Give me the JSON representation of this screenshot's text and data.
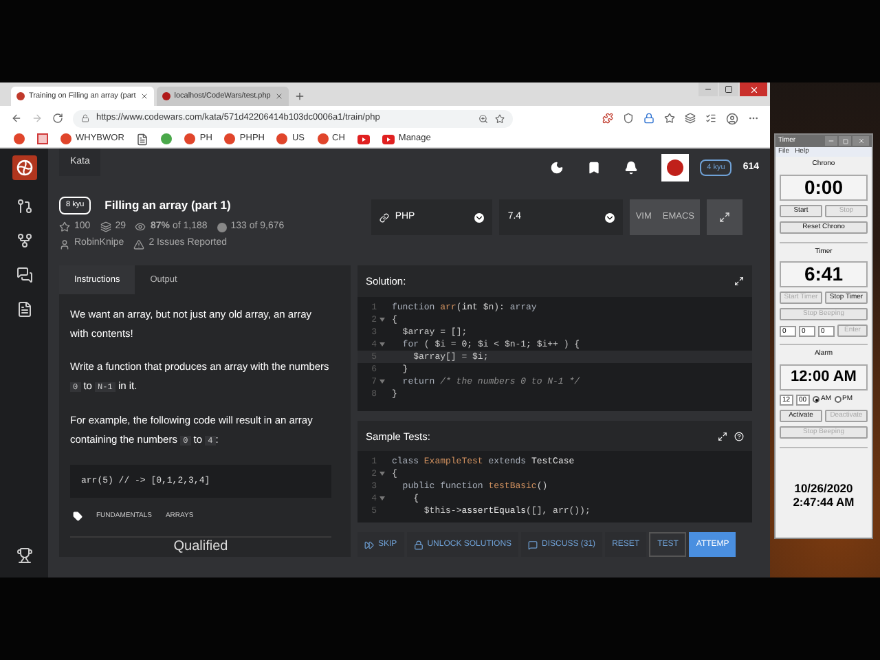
{
  "browser": {
    "tabs": [
      {
        "title": "Training on Filling an array (part",
        "selected": true
      },
      {
        "title": "localhost/CodeWars/test.php",
        "selected": false
      }
    ],
    "url": "https://www.codewars.com/kata/571d42206414b103dc0006a1/train/php",
    "bookmarks": [
      {
        "kind": "round"
      },
      {
        "kind": "square"
      },
      {
        "kind": "round",
        "label": "WHYBWOR"
      },
      {
        "kind": "page"
      },
      {
        "kind": "leaf"
      },
      {
        "kind": "round",
        "label": "PH"
      },
      {
        "kind": "round",
        "label": "PHPH"
      },
      {
        "kind": "round",
        "label": "US"
      },
      {
        "kind": "round",
        "label": "CH"
      },
      {
        "kind": "video"
      },
      {
        "kind": "video",
        "label": "Manage"
      }
    ]
  },
  "nav": {
    "section": "Kata"
  },
  "user": {
    "rank": "4 kyu",
    "honor": "614"
  },
  "kata": {
    "rank": "8 kyu",
    "title": "Filling an array (part 1)",
    "stats": [
      {
        "kind": "star",
        "text": "100"
      },
      {
        "kind": "stack",
        "text": "29"
      },
      {
        "kind": "eye",
        "text": "**87%** of 1,188"
      },
      {
        "kind": "count",
        "text": "133 of 9,676"
      },
      {
        "kind": "user",
        "text": "RobinKnipe"
      },
      {
        "kind": "warning",
        "text": "2 Issues Reported"
      }
    ]
  },
  "editor_bar": {
    "language": "PHP",
    "version": "7.4",
    "modes": [
      "VIM",
      "EMACS"
    ]
  },
  "instructions": {
    "tabs": [
      {
        "label": "Instructions",
        "selected": true
      },
      {
        "label": "Output",
        "selected": false
      }
    ],
    "paragraphs": [
      [
        {
          "kind": "text",
          "text": "We want an array, but not just any old array, an array with contents!"
        }
      ],
      [
        {
          "kind": "text",
          "text": "Write a function that produces an array with the numbers "
        },
        {
          "kind": "code",
          "text": "0"
        },
        {
          "kind": "text",
          "text": " to "
        },
        {
          "kind": "code",
          "text": "N-1"
        },
        {
          "kind": "text",
          "text": " in it."
        }
      ],
      [
        {
          "kind": "text",
          "text": "For example, the following code will result in an array containing the numbers "
        },
        {
          "kind": "code",
          "text": "0"
        },
        {
          "kind": "text",
          "text": " to "
        },
        {
          "kind": "code",
          "text": "4"
        },
        {
          "kind": "text",
          "text": ":"
        }
      ]
    ],
    "example": "arr(5) // -> [0,1,2,3,4]",
    "tags": [
      "FUNDAMENTALS",
      "ARRAYS"
    ],
    "footer": "Qualified"
  },
  "solution": {
    "title": "Solution:",
    "lines": [
      {
        "num": "1",
        "fold": false,
        "current": false,
        "tokens": [
          {
            "kind": "kw",
            "text": "function "
          },
          {
            "kind": "fn",
            "text": "arr"
          },
          {
            "kind": "plain",
            "text": "("
          },
          {
            "kind": "type",
            "text": "int"
          },
          {
            "kind": "var",
            "text": " $n"
          },
          {
            "kind": "plain",
            "text": "): "
          },
          {
            "kind": "kw",
            "text": "array"
          }
        ]
      },
      {
        "num": "2",
        "fold": true,
        "current": false,
        "tokens": [
          {
            "kind": "plain",
            "text": "{"
          }
        ]
      },
      {
        "num": "3",
        "fold": false,
        "current": false,
        "tokens": [
          {
            "kind": "var",
            "text": "  $array"
          },
          {
            "kind": "plain",
            "text": " = [];"
          }
        ]
      },
      {
        "num": "4",
        "fold": true,
        "current": false,
        "tokens": [
          {
            "kind": "kw",
            "text": "  for"
          },
          {
            "kind": "plain",
            "text": " ( $i = "
          },
          {
            "kind": "num",
            "text": "0"
          },
          {
            "kind": "plain",
            "text": "; $i < $n-1; $i++ ) {"
          }
        ]
      },
      {
        "num": "5",
        "fold": false,
        "current": true,
        "tokens": [
          {
            "kind": "var",
            "text": "    $array"
          },
          {
            "kind": "plain",
            "text": "[] = $i;"
          }
        ]
      },
      {
        "num": "6",
        "fold": false,
        "current": false,
        "tokens": [
          {
            "kind": "plain",
            "text": "  }"
          }
        ]
      },
      {
        "num": "7",
        "fold": true,
        "current": false,
        "tokens": [
          {
            "kind": "kw",
            "text": "  return "
          },
          {
            "kind": "comment",
            "text": "/* the numbers 0 to N-1 */"
          }
        ]
      },
      {
        "num": "8",
        "fold": false,
        "current": false,
        "tokens": [
          {
            "kind": "plain",
            "text": "}"
          }
        ]
      }
    ]
  },
  "tests": {
    "title": "Sample Tests:",
    "lines": [
      {
        "num": "1",
        "fold": false,
        "current": false,
        "tokens": [
          {
            "kind": "kw",
            "text": "class "
          },
          {
            "kind": "fn",
            "text": "ExampleTest"
          },
          {
            "kind": "kw",
            "text": " extends "
          },
          {
            "kind": "type",
            "text": "TestCase"
          }
        ]
      },
      {
        "num": "2",
        "fold": true,
        "current": false,
        "tokens": [
          {
            "kind": "plain",
            "text": "{"
          }
        ]
      },
      {
        "num": "3",
        "fold": false,
        "current": false,
        "tokens": [
          {
            "kind": "kw",
            "text": "  public function "
          },
          {
            "kind": "fn",
            "text": "testBasic"
          },
          {
            "kind": "plain",
            "text": "()"
          }
        ]
      },
      {
        "num": "4",
        "fold": true,
        "current": false,
        "tokens": [
          {
            "kind": "plain",
            "text": "    {"
          }
        ]
      },
      {
        "num": "5",
        "fold": false,
        "current": false,
        "tokens": [
          {
            "kind": "var",
            "text": "      $this"
          },
          {
            "kind": "plain",
            "text": "->"
          },
          {
            "kind": "type",
            "text": "assertEquals"
          },
          {
            "kind": "plain",
            "text": "([], arr());"
          }
        ]
      }
    ]
  },
  "actions": [
    {
      "kind": "skip",
      "label": "SKIP"
    },
    {
      "kind": "unlock",
      "label": "UNLOCK SOLUTIONS"
    },
    {
      "kind": "discuss",
      "label": "DISCUSS (31)"
    },
    {
      "kind": "plain",
      "label": "RESET"
    },
    {
      "kind": "outline",
      "label": "TEST"
    },
    {
      "kind": "primary",
      "label": "ATTEMP"
    }
  ],
  "timer_app": {
    "title": "Timer",
    "menu": [
      "File",
      "Help"
    ],
    "chrono": {
      "label": "Chrono",
      "display": "0:00",
      "buttons": [
        {
          "label": "Start",
          "disabled": false
        },
        {
          "label": "Stop",
          "disabled": true
        }
      ],
      "reset": {
        "label": "Reset Chrono",
        "disabled": false
      }
    },
    "timer": {
      "label": "Timer",
      "display": "6:41",
      "buttons": [
        {
          "label": "Start Timer",
          "disabled": true
        },
        {
          "label": "Stop Timer",
          "disabled": false
        }
      ],
      "beep": {
        "label": "Stop Beeping",
        "disabled": true
      },
      "fields": [
        "0",
        "0",
        "0"
      ],
      "enter": {
        "label": "Enter",
        "disabled": true
      }
    },
    "alarm": {
      "label": "Alarm",
      "display": "12:00 AM",
      "fields": [
        "12",
        "00"
      ],
      "periods": [
        {
          "label": "AM",
          "selected": true
        },
        {
          "label": "PM",
          "selected": false
        }
      ],
      "buttons": [
        {
          "label": "Activate",
          "disabled": false
        },
        {
          "label": "Deactivate",
          "disabled": true
        }
      ],
      "beep": {
        "label": "Stop Beeping",
        "disabled": true
      }
    },
    "date": "10/26/2020",
    "time": "2:47:44 AM"
  }
}
